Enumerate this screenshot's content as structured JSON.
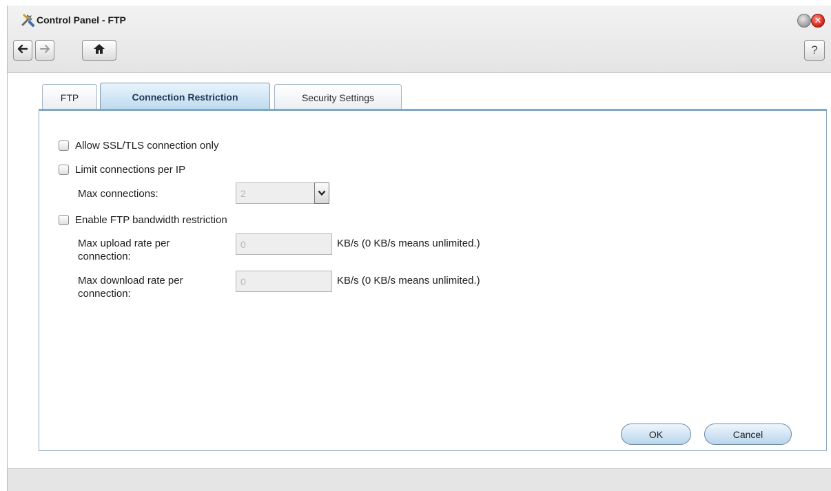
{
  "window": {
    "title": "Control Panel - FTP",
    "close_glyph": "✕"
  },
  "toolbar": {
    "back_icon": "back-arrow-icon",
    "forward_icon": "forward-arrow-icon",
    "home_icon": "home-icon",
    "help_label": "?"
  },
  "tabs": [
    {
      "label": "FTP",
      "active": false
    },
    {
      "label": "Connection Restriction",
      "active": true
    },
    {
      "label": "Security Settings",
      "active": false
    }
  ],
  "form": {
    "ssl_only": {
      "label": "Allow SSL/TLS connection only",
      "checked": false
    },
    "limit_per_ip": {
      "label": "Limit connections per IP",
      "checked": false
    },
    "max_connections": {
      "label": "Max connections:",
      "value": "2"
    },
    "bandwidth": {
      "label": "Enable FTP bandwidth restriction",
      "checked": false
    },
    "upload": {
      "label_line1": "Max upload rate per",
      "label_line2": "connection:",
      "value": "0",
      "hint": "KB/s (0 KB/s means unlimited.)"
    },
    "download": {
      "label_line1": "Max download rate per",
      "label_line2": "connection:",
      "value": "0",
      "hint": "KB/s (0 KB/s means unlimited.)"
    }
  },
  "buttons": {
    "ok_label": "OK",
    "cancel_label": "Cancel"
  },
  "colors": {
    "accent": "#7fa7c6",
    "close_red": "#d7261b"
  }
}
